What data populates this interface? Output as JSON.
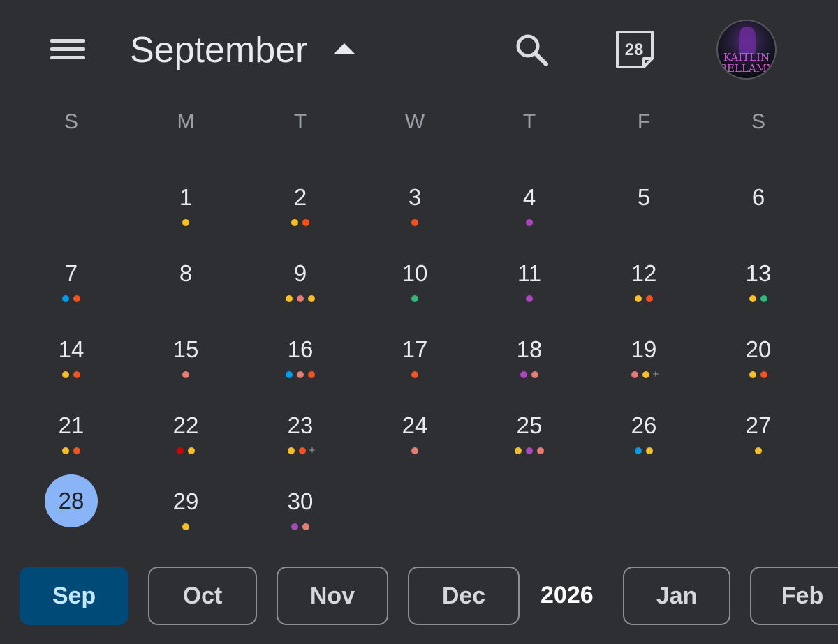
{
  "header": {
    "month_title": "September",
    "today_icon_text": "28",
    "avatar_text_line1": "KAITLIN",
    "avatar_text_line2": "BELLAMY",
    "icons": [
      "menu-icon",
      "caret-up-icon",
      "search-icon",
      "today-calendar-icon",
      "avatar"
    ]
  },
  "weekdays": [
    "S",
    "M",
    "T",
    "W",
    "T",
    "F",
    "S"
  ],
  "colors": {
    "background": "#2e2f32",
    "yellow": "#f6bf26",
    "orange": "#f4511e",
    "coral": "#e67c73",
    "purple": "#ab47bc",
    "blue": "#039be5",
    "green": "#33b679",
    "red": "#d50000",
    "today": "#8ab4f8",
    "active_chip": "#004a77"
  },
  "weeks": [
    [
      null,
      {
        "day": "1",
        "dots": [
          "yellow"
        ]
      },
      {
        "day": "2",
        "dots": [
          "yellow",
          "orange"
        ]
      },
      {
        "day": "3",
        "dots": [
          "orange"
        ]
      },
      {
        "day": "4",
        "dots": [
          "purple"
        ]
      },
      {
        "day": "5",
        "dots": []
      },
      {
        "day": "6",
        "dots": []
      }
    ],
    [
      {
        "day": "7",
        "dots": [
          "blue",
          "orange"
        ]
      },
      {
        "day": "8",
        "dots": []
      },
      {
        "day": "9",
        "dots": [
          "yellow",
          "coral",
          "yellow"
        ]
      },
      {
        "day": "10",
        "dots": [
          "green"
        ]
      },
      {
        "day": "11",
        "dots": [
          "purple"
        ]
      },
      {
        "day": "12",
        "dots": [
          "yellow",
          "orange"
        ]
      },
      {
        "day": "13",
        "dots": [
          "yellow",
          "green"
        ]
      }
    ],
    [
      {
        "day": "14",
        "dots": [
          "yellow",
          "orange"
        ]
      },
      {
        "day": "15",
        "dots": [
          "coral"
        ]
      },
      {
        "day": "16",
        "dots": [
          "blue",
          "coral",
          "orange"
        ]
      },
      {
        "day": "17",
        "dots": [
          "orange"
        ]
      },
      {
        "day": "18",
        "dots": [
          "purple",
          "coral"
        ]
      },
      {
        "day": "19",
        "dots": [
          "coral",
          "yellow"
        ],
        "more": "+"
      },
      {
        "day": "20",
        "dots": [
          "yellow",
          "orange"
        ]
      }
    ],
    [
      {
        "day": "21",
        "dots": [
          "yellow",
          "orange"
        ]
      },
      {
        "day": "22",
        "dots": [
          "red",
          "yellow"
        ]
      },
      {
        "day": "23",
        "dots": [
          "yellow",
          "orange"
        ],
        "more": "+"
      },
      {
        "day": "24",
        "dots": [
          "coral"
        ]
      },
      {
        "day": "25",
        "dots": [
          "yellow",
          "purple",
          "coral"
        ]
      },
      {
        "day": "26",
        "dots": [
          "blue",
          "yellow"
        ]
      },
      {
        "day": "27",
        "dots": [
          "yellow"
        ]
      }
    ],
    [
      {
        "day": "28",
        "dots": [],
        "today": true
      },
      {
        "day": "29",
        "dots": [
          "yellow"
        ]
      },
      {
        "day": "30",
        "dots": [
          "purple",
          "coral"
        ]
      },
      null,
      null,
      null,
      null
    ]
  ],
  "month_bar": {
    "chips": [
      {
        "label": "Sep",
        "active": true
      },
      {
        "label": "Oct"
      },
      {
        "label": "Nov"
      },
      {
        "label": "Dec"
      },
      {
        "label": "Jan"
      },
      {
        "label": "Feb"
      }
    ],
    "year_label": "2026"
  }
}
